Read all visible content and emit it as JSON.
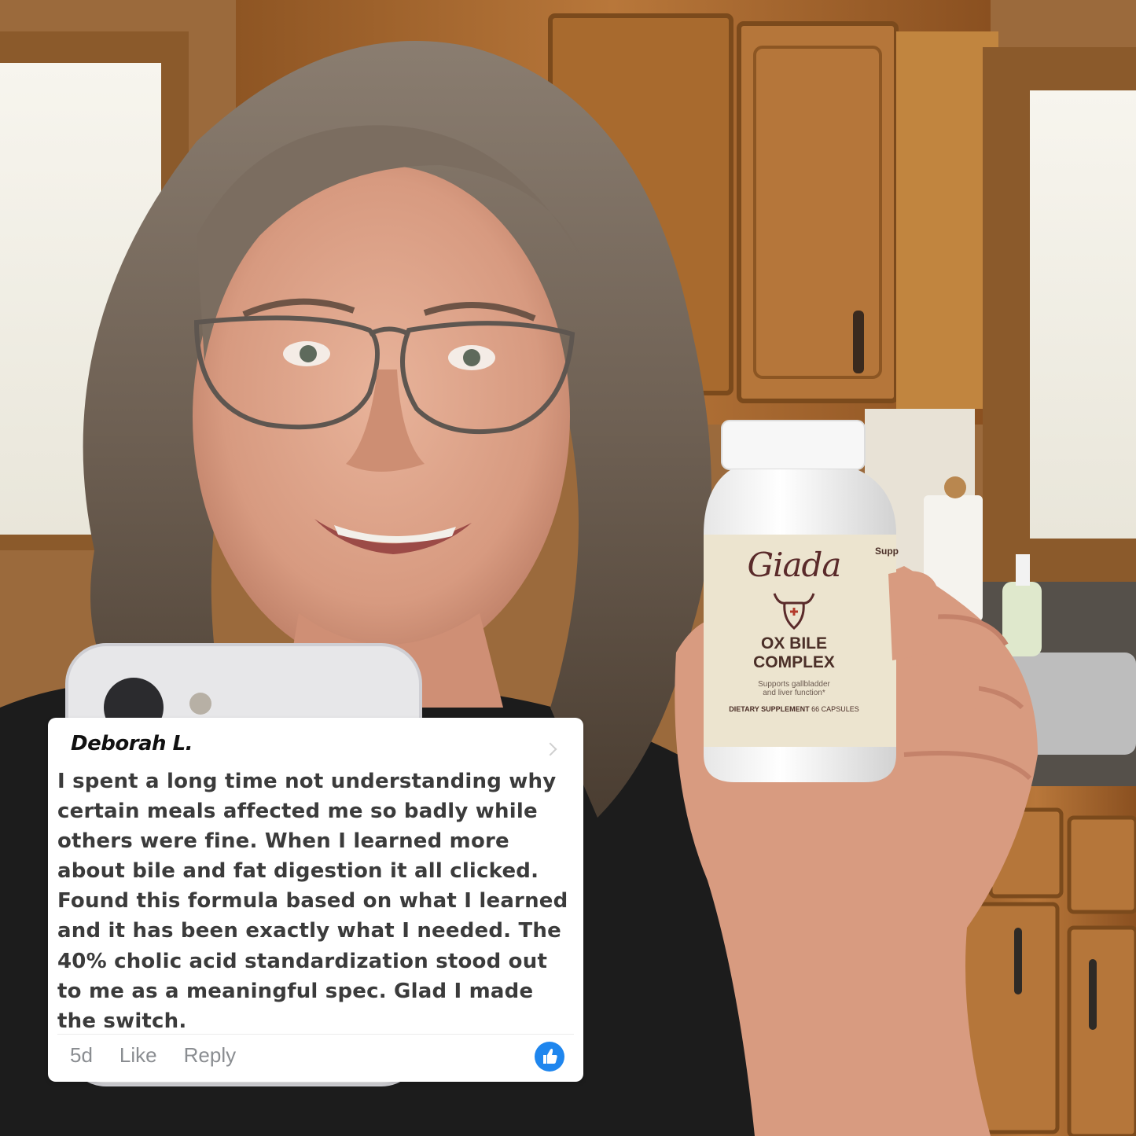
{
  "comment": {
    "author": "Deborah L.",
    "text": " I spent a long time not understanding why\ncertain meals affected me so badly while\nothers were fine. When I learned more\nabout bile and fat digestion it all clicked.\nFound this formula based on what I learned\nand it has been exactly what I needed. The\n40% cholic acid standardization stood out\nto me as a meaningful spec. Glad I made\nthe switch.",
    "time": "5d",
    "like_label": "Like",
    "reply_label": "Reply",
    "like_icon": "thumbs-up-icon",
    "chevron_icon": "chevron-right-icon"
  },
  "product": {
    "brand": "Giada",
    "name_line1": "OX BILE",
    "name_line2": "COMPLEX",
    "tagline_line1": "Supports gallbladder",
    "tagline_line2": "and liver function*",
    "type": "DIETARY SUPPLEMENT",
    "count": "66 CAPSULES",
    "side_label": "Supp"
  },
  "colors": {
    "like_blue": "#1f86ee",
    "cabinet_wood": "#a8692b",
    "label_cream": "#ece4cf",
    "brand_maroon": "#5a2a2a"
  }
}
